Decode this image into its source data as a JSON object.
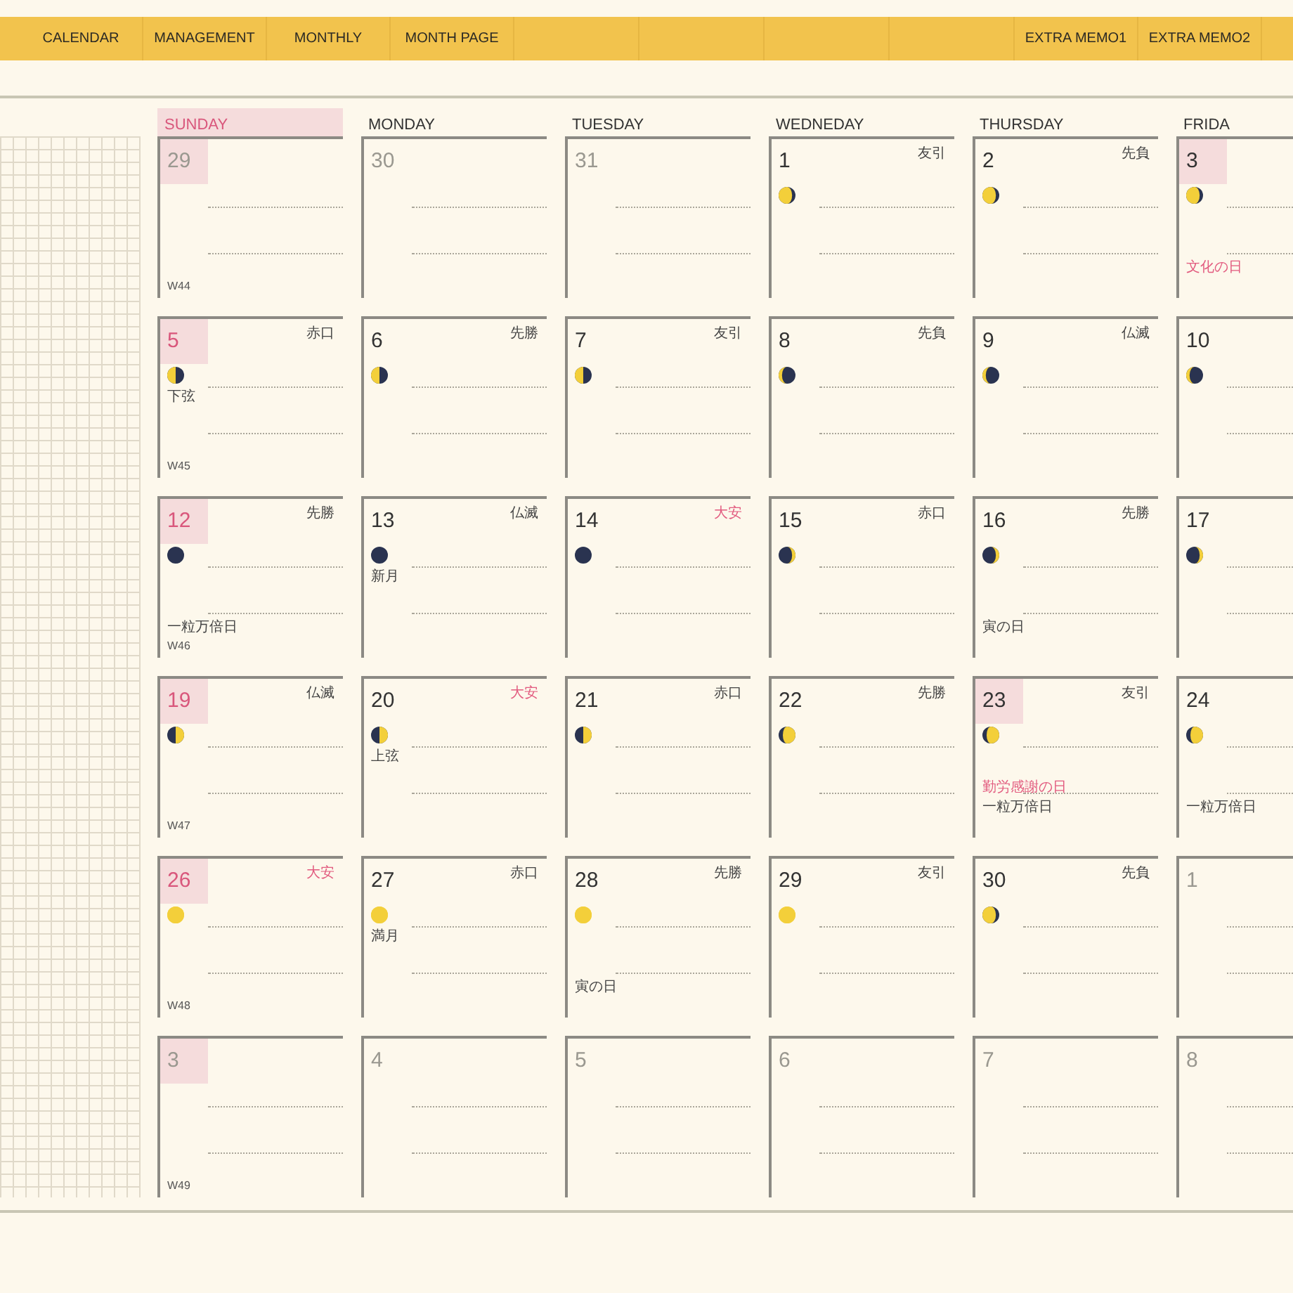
{
  "tabs_left": [
    {
      "label": "CALENDAR"
    },
    {
      "label": "MANAGEMENT"
    },
    {
      "label": "MONTHLY"
    },
    {
      "label": "MONTH PAGE"
    }
  ],
  "tabs_right": [
    {
      "label": "EXTRA MEMO1"
    },
    {
      "label": "EXTRA MEMO2"
    }
  ],
  "weekdays": [
    {
      "label": "SUNDAY",
      "highlighted": true
    },
    {
      "label": "MONDAY",
      "highlighted": false
    },
    {
      "label": "TUESDAY",
      "highlighted": false
    },
    {
      "label": "WEDNEDAY",
      "highlighted": false
    },
    {
      "label": "THURSDAY",
      "highlighted": false
    },
    {
      "label": "FRIDA",
      "highlighted": false
    }
  ],
  "weeks": [
    {
      "week": "W44",
      "days": [
        {
          "day": "29",
          "muted": true,
          "highlighted": true
        },
        {
          "day": "30",
          "muted": true,
          "highlighted": false
        },
        {
          "day": "31",
          "muted": true,
          "highlighted": false
        },
        {
          "day": "1",
          "muted": false,
          "highlighted": false,
          "rokuyo": {
            "text": "友引",
            "auspicious": false
          },
          "kind": "waning_gibbous"
        },
        {
          "day": "2",
          "muted": false,
          "highlighted": false,
          "rokuyo": {
            "text": "先負",
            "auspicious": false
          },
          "kind": "waning_gibbous"
        },
        {
          "day": "3",
          "muted": false,
          "highlighted": true,
          "kind": "waning_gibbous",
          "notes": [
            {
              "kind": "holiday",
              "text": "文化の日"
            }
          ]
        }
      ]
    },
    {
      "week": "W45",
      "days": [
        {
          "day": "5",
          "muted": false,
          "highlighted": true,
          "rokuyo": {
            "text": "赤口",
            "auspicious": false
          },
          "kind": "last_quarter",
          "notes": [
            {
              "kind": "phase_name",
              "text": "下弦"
            }
          ]
        },
        {
          "day": "6",
          "muted": false,
          "highlighted": false,
          "rokuyo": {
            "text": "先勝",
            "auspicious": false
          },
          "kind": "last_quarter"
        },
        {
          "day": "7",
          "muted": false,
          "highlighted": false,
          "rokuyo": {
            "text": "友引",
            "auspicious": false
          },
          "kind": "last_quarter"
        },
        {
          "day": "8",
          "muted": false,
          "highlighted": false,
          "rokuyo": {
            "text": "先負",
            "auspicious": false
          },
          "kind": "waning_crescent"
        },
        {
          "day": "9",
          "muted": false,
          "highlighted": false,
          "rokuyo": {
            "text": "仏滅",
            "auspicious": false
          },
          "kind": "waning_crescent"
        },
        {
          "day": "10",
          "muted": false,
          "highlighted": false,
          "kind": "waning_crescent"
        }
      ]
    },
    {
      "week": "W46",
      "days": [
        {
          "day": "12",
          "muted": false,
          "highlighted": true,
          "rokuyo": {
            "text": "先勝",
            "auspicious": false
          },
          "kind": "new_moon",
          "notes": [
            {
              "kind": "event",
              "text": "一粒万倍日"
            }
          ]
        },
        {
          "day": "13",
          "muted": false,
          "highlighted": false,
          "rokuyo": {
            "text": "仏滅",
            "auspicious": false
          },
          "kind": "new_moon",
          "notes": [
            {
              "kind": "phase_name",
              "text": "新月"
            }
          ]
        },
        {
          "day": "14",
          "muted": false,
          "highlighted": false,
          "rokuyo": {
            "text": "大安",
            "auspicious": true
          },
          "kind": "new_moon"
        },
        {
          "day": "15",
          "muted": false,
          "highlighted": false,
          "rokuyo": {
            "text": "赤口",
            "auspicious": false
          },
          "kind": "waxing_crescent"
        },
        {
          "day": "16",
          "muted": false,
          "highlighted": false,
          "rokuyo": {
            "text": "先勝",
            "auspicious": false
          },
          "kind": "waxing_crescent",
          "notes": [
            {
              "kind": "event",
              "text": "寅の日"
            }
          ]
        },
        {
          "day": "17",
          "muted": false,
          "highlighted": false,
          "kind": "waxing_crescent"
        }
      ]
    },
    {
      "week": "W47",
      "days": [
        {
          "day": "19",
          "muted": false,
          "highlighted": true,
          "rokuyo": {
            "text": "仏滅",
            "auspicious": false
          },
          "kind": "first_quarter"
        },
        {
          "day": "20",
          "muted": false,
          "highlighted": false,
          "rokuyo": {
            "text": "大安",
            "auspicious": true
          },
          "kind": "first_quarter",
          "notes": [
            {
              "kind": "phase_name",
              "text": "上弦"
            }
          ]
        },
        {
          "day": "21",
          "muted": false,
          "highlighted": false,
          "rokuyo": {
            "text": "赤口",
            "auspicious": false
          },
          "kind": "first_quarter"
        },
        {
          "day": "22",
          "muted": false,
          "highlighted": false,
          "rokuyo": {
            "text": "先勝",
            "auspicious": false
          },
          "kind": "waxing_gibbous"
        },
        {
          "day": "23",
          "muted": false,
          "highlighted": true,
          "rokuyo": {
            "text": "友引",
            "auspicious": false
          },
          "kind": "waxing_gibbous",
          "notes": [
            {
              "kind": "holiday",
              "text": "勤労感謝の日"
            },
            {
              "kind": "event",
              "text": "一粒万倍日"
            }
          ]
        },
        {
          "day": "24",
          "muted": false,
          "highlighted": false,
          "kind": "waxing_gibbous",
          "notes": [
            {
              "kind": "event",
              "text": "一粒万倍日"
            }
          ]
        }
      ]
    },
    {
      "week": "W48",
      "days": [
        {
          "day": "26",
          "muted": false,
          "highlighted": true,
          "rokuyo": {
            "text": "大安",
            "auspicious": true
          },
          "kind": "full_moon"
        },
        {
          "day": "27",
          "muted": false,
          "highlighted": false,
          "rokuyo": {
            "text": "赤口",
            "auspicious": false
          },
          "kind": "full_moon",
          "notes": [
            {
              "kind": "phase_name",
              "text": "満月"
            }
          ]
        },
        {
          "day": "28",
          "muted": false,
          "highlighted": false,
          "rokuyo": {
            "text": "先勝",
            "auspicious": false
          },
          "kind": "full_moon",
          "notes": [
            {
              "kind": "event",
              "text": "寅の日"
            }
          ]
        },
        {
          "day": "29",
          "muted": false,
          "highlighted": false,
          "rokuyo": {
            "text": "友引",
            "auspicious": false
          },
          "kind": "full_moon"
        },
        {
          "day": "30",
          "muted": false,
          "highlighted": false,
          "rokuyo": {
            "text": "先負",
            "auspicious": false
          },
          "kind": "waning_gibbous"
        },
        {
          "day": "1",
          "muted": true,
          "highlighted": false
        }
      ]
    },
    {
      "week": "W49",
      "days": [
        {
          "day": "3",
          "muted": true,
          "highlighted": true
        },
        {
          "day": "4",
          "muted": true,
          "highlighted": false
        },
        {
          "day": "5",
          "muted": true,
          "highlighted": false
        },
        {
          "day": "6",
          "muted": true,
          "highlighted": false
        },
        {
          "day": "7",
          "muted": true,
          "highlighted": false
        },
        {
          "day": "8",
          "muted": true,
          "highlighted": false
        }
      ]
    }
  ]
}
